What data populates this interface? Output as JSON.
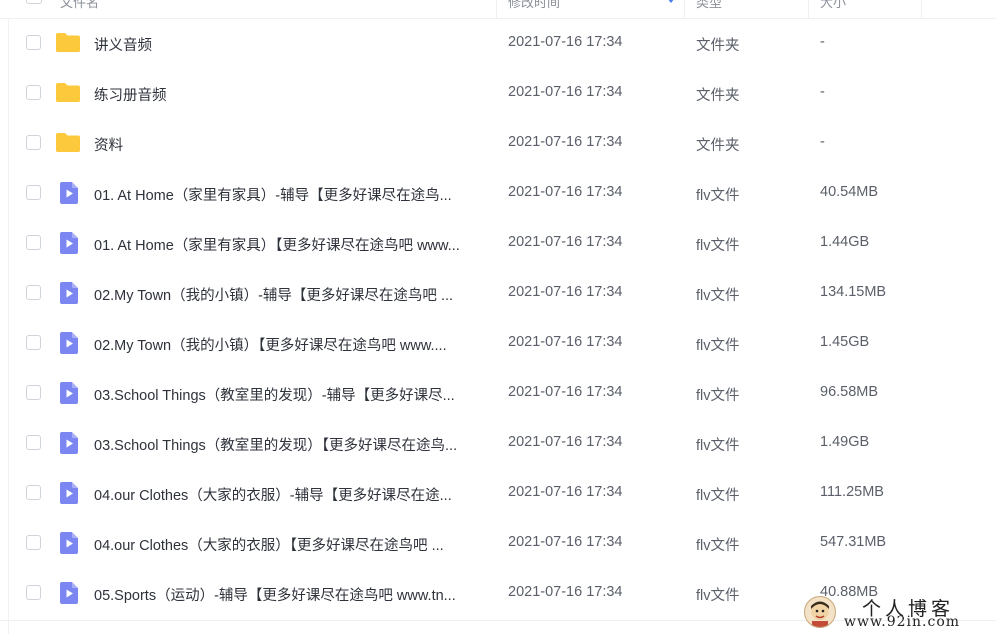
{
  "header": {
    "name_label": "文件名",
    "time_label": "修改时间",
    "type_label": "类型",
    "size_label": "大小"
  },
  "files": [
    {
      "kind": "folder",
      "name": "讲义音频",
      "time": "2021-07-16 17:34",
      "type": "文件夹",
      "size": "-"
    },
    {
      "kind": "folder",
      "name": "练习册音频",
      "time": "2021-07-16 17:34",
      "type": "文件夹",
      "size": "-"
    },
    {
      "kind": "folder",
      "name": "资料",
      "time": "2021-07-16 17:34",
      "type": "文件夹",
      "size": "-"
    },
    {
      "kind": "video",
      "name": "01. At Home（家里有家具）-辅导【更多好课尽在途鸟...",
      "time": "2021-07-16 17:34",
      "type": "flv文件",
      "size": "40.54MB"
    },
    {
      "kind": "video",
      "name": "01. At Home（家里有家具）【更多好课尽在途鸟吧 www...",
      "time": "2021-07-16 17:34",
      "type": "flv文件",
      "size": "1.44GB"
    },
    {
      "kind": "video",
      "name": "02.My Town（我的小镇）-辅导【更多好课尽在途鸟吧 ...",
      "time": "2021-07-16 17:34",
      "type": "flv文件",
      "size": "134.15MB"
    },
    {
      "kind": "video",
      "name": "02.My Town（我的小镇）【更多好课尽在途鸟吧 www....",
      "time": "2021-07-16 17:34",
      "type": "flv文件",
      "size": "1.45GB"
    },
    {
      "kind": "video",
      "name": "03.School Things（教室里的发现）-辅导【更多好课尽...",
      "time": "2021-07-16 17:34",
      "type": "flv文件",
      "size": "96.58MB"
    },
    {
      "kind": "video",
      "name": "03.School Things（教室里的发现）【更多好课尽在途鸟...",
      "time": "2021-07-16 17:34",
      "type": "flv文件",
      "size": "1.49GB"
    },
    {
      "kind": "video",
      "name": "04.our Clothes（大家的衣服）-辅导【更多好课尽在途...",
      "time": "2021-07-16 17:34",
      "type": "flv文件",
      "size": "111.25MB"
    },
    {
      "kind": "video",
      "name": "04.our Clothes（大家的衣服）【更多好课尽在途鸟吧 ...",
      "time": "2021-07-16 17:34",
      "type": "flv文件",
      "size": "547.31MB"
    },
    {
      "kind": "video",
      "name": "05.Sports（运动）-辅导【更多好课尽在途鸟吧 www.tn...",
      "time": "2021-07-16 17:34",
      "type": "flv文件",
      "size": "40.88MB"
    }
  ],
  "watermark": {
    "title": "个人博客",
    "url": "www.92in.com"
  },
  "colors": {
    "folder": "#fcc93d",
    "video": "#7b86f2",
    "sort_accent": "#4e7df0"
  },
  "icons": {
    "folder": "folder-icon",
    "video": "video-file-icon",
    "sort": "sort-desc-icon"
  }
}
